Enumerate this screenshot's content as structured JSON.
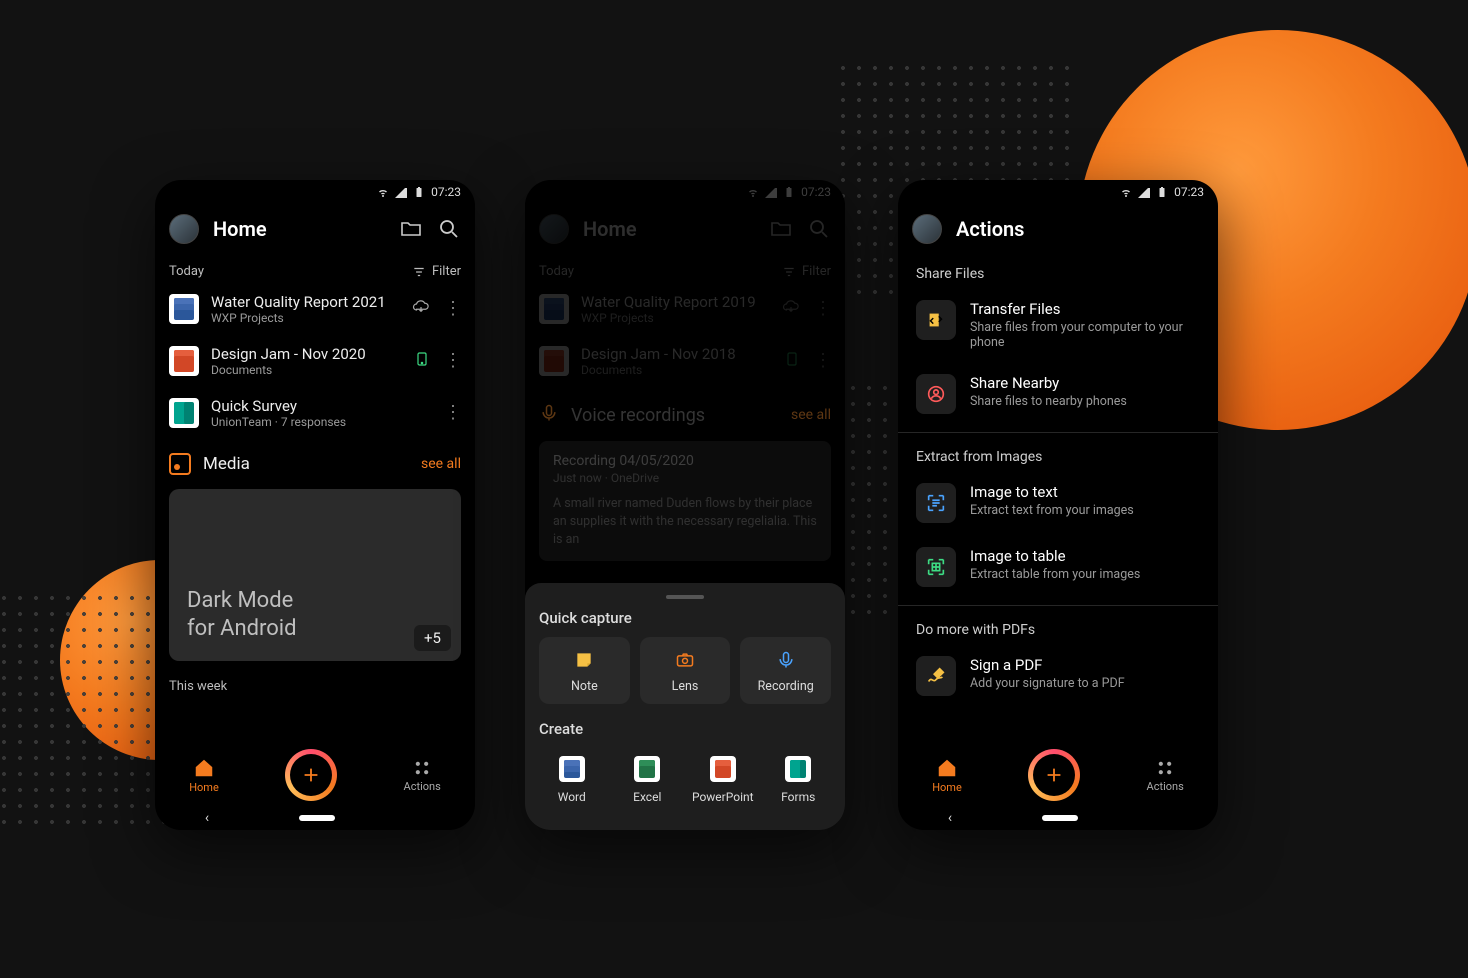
{
  "status": {
    "time": "07:23"
  },
  "nav": {
    "home": "Home",
    "actions": "Actions"
  },
  "p1": {
    "title": "Home",
    "today": "Today",
    "filter": "Filter",
    "docs": [
      {
        "title": "Water Quality Report 2021",
        "sub": "WXP Projects"
      },
      {
        "title": "Design Jam - Nov 2020",
        "sub": "Documents"
      },
      {
        "title": "Quick Survey",
        "sub": "UnionTeam · 7 responses"
      }
    ],
    "media": {
      "label": "Media",
      "see_all": "see all",
      "caption": "Dark Mode\nfor Android",
      "more": "+5"
    },
    "this_week": "This week"
  },
  "p2": {
    "title": "Home",
    "today": "Today",
    "filter": "Filter",
    "docs": [
      {
        "title": "Water Quality Report 2019",
        "sub": "WXP Projects"
      },
      {
        "title": "Design Jam - Nov 2018",
        "sub": "Documents"
      }
    ],
    "voice": {
      "label": "Voice recordings",
      "see_all": "see all",
      "card": {
        "title": "Recording 04/05/2020",
        "sub": "Just now · OneDrive",
        "body": "A small river named Duden flows by their place an supplies it with the necessary regelialia. This is an"
      }
    },
    "sheet": {
      "quick": "Quick capture",
      "items": [
        "Note",
        "Lens",
        "Recording"
      ],
      "create": "Create",
      "apps": [
        "Word",
        "Excel",
        "PowerPoint",
        "Forms"
      ]
    }
  },
  "p3": {
    "title": "Actions",
    "groups": [
      {
        "title": "Share Files",
        "items": [
          {
            "t": "Transfer Files",
            "s": "Share files from your computer to your phone"
          },
          {
            "t": "Share Nearby",
            "s": "Share files to nearby phones"
          }
        ]
      },
      {
        "title": "Extract from Images",
        "items": [
          {
            "t": "Image to text",
            "s": "Extract text from your images"
          },
          {
            "t": "Image to table",
            "s": "Extract table from your images"
          }
        ]
      },
      {
        "title": "Do more with PDFs",
        "items": [
          {
            "t": "Sign a PDF",
            "s": "Add your signature to a PDF"
          }
        ]
      }
    ]
  }
}
